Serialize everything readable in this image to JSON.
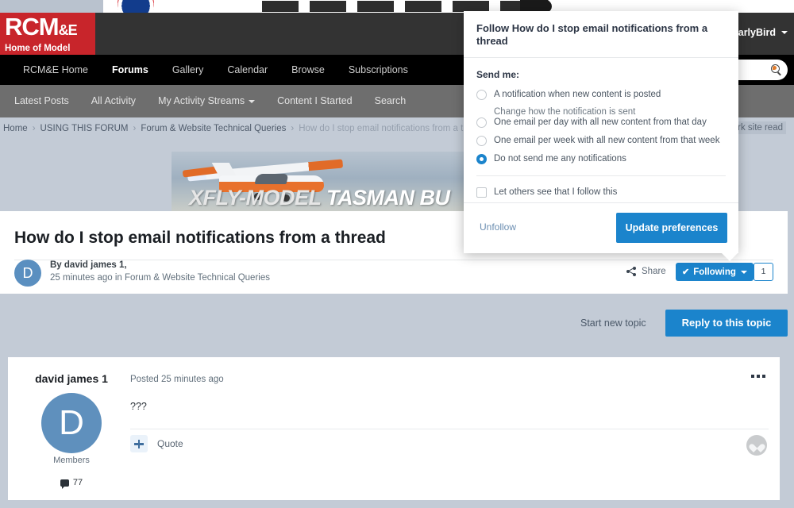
{
  "site": {
    "logo_line1": "RCM",
    "logo_amp": "&E",
    "logo_line2": "Home of Model Flying"
  },
  "header": {
    "user_name": "EarlyBird",
    "user_caret": "caret-down-icon",
    "avatar": "user-avatar"
  },
  "primary_nav": {
    "items": [
      {
        "label": "RCM&E Home",
        "active": false
      },
      {
        "label": "Forums",
        "active": true
      },
      {
        "label": "Gallery",
        "active": false
      },
      {
        "label": "Calendar",
        "active": false
      },
      {
        "label": "Browse",
        "active": false
      },
      {
        "label": "Subscriptions",
        "active": false
      }
    ],
    "search_placeholder": "",
    "search_value": ""
  },
  "secondary_nav": {
    "items": [
      {
        "label": "Latest Posts",
        "caret": false
      },
      {
        "label": "All Activity",
        "caret": false
      },
      {
        "label": "My Activity Streams",
        "caret": true
      },
      {
        "label": "Content I Started",
        "caret": false
      },
      {
        "label": "Search",
        "caret": false
      }
    ]
  },
  "breadcrumb": {
    "items": [
      "Home",
      "USING THIS FORUM",
      "Forum & Website Technical Queries"
    ],
    "current": "How do I stop email notifications from a thread",
    "separator": "›",
    "mark_site_read": "Mark site read"
  },
  "banner_ad": {
    "brand": "XFLY-MODEL",
    "product": "TASMAN BU"
  },
  "topic": {
    "title": "How do I stop email notifications from a thread",
    "avatar_letter": "D",
    "by_prefix": "By",
    "author": "david james 1",
    "by_suffix": ",",
    "meta": "25 minutes ago in Forum & Website Technical Queries",
    "share_label": "Share",
    "following_label": "Following",
    "following_check": "✔",
    "following_count": "1",
    "start_new_topic": "Start new topic",
    "reply_label": "Reply to this topic"
  },
  "post": {
    "author": "david james 1",
    "avatar_letter": "D",
    "role": "Members",
    "post_count": "77",
    "posted": "Posted 25 minutes ago",
    "body": "???",
    "quote_label": "Quote",
    "plus_icon": "plus-icon",
    "more_icon": "more-options-icon",
    "like_icon": "heart-icon"
  },
  "follow_dialog": {
    "title": "Follow How do I stop email notifications from a thread",
    "send_me_label": "Send me:",
    "options": [
      {
        "label": "A notification when new content is posted",
        "sub": "Change how the notification is sent",
        "selected": false
      },
      {
        "label": "One email per day with all new content from that day",
        "sub": "",
        "selected": false
      },
      {
        "label": "One email per week with all new content from that week",
        "sub": "",
        "selected": false
      },
      {
        "label": "Do not send me any notifications",
        "sub": "",
        "selected": true
      }
    ],
    "anonymous_label": "Let others see that I follow this",
    "anonymous_checked": false,
    "unfollow_label": "Unfollow",
    "update_label": "Update preferences"
  },
  "colors": {
    "brand_red": "#c8252b",
    "accent_blue": "#1b84cc",
    "page_bg": "#c3cbd6",
    "header_dark": "#333333",
    "nav_black": "#000000",
    "nav_grey": "#6e6e6e"
  }
}
